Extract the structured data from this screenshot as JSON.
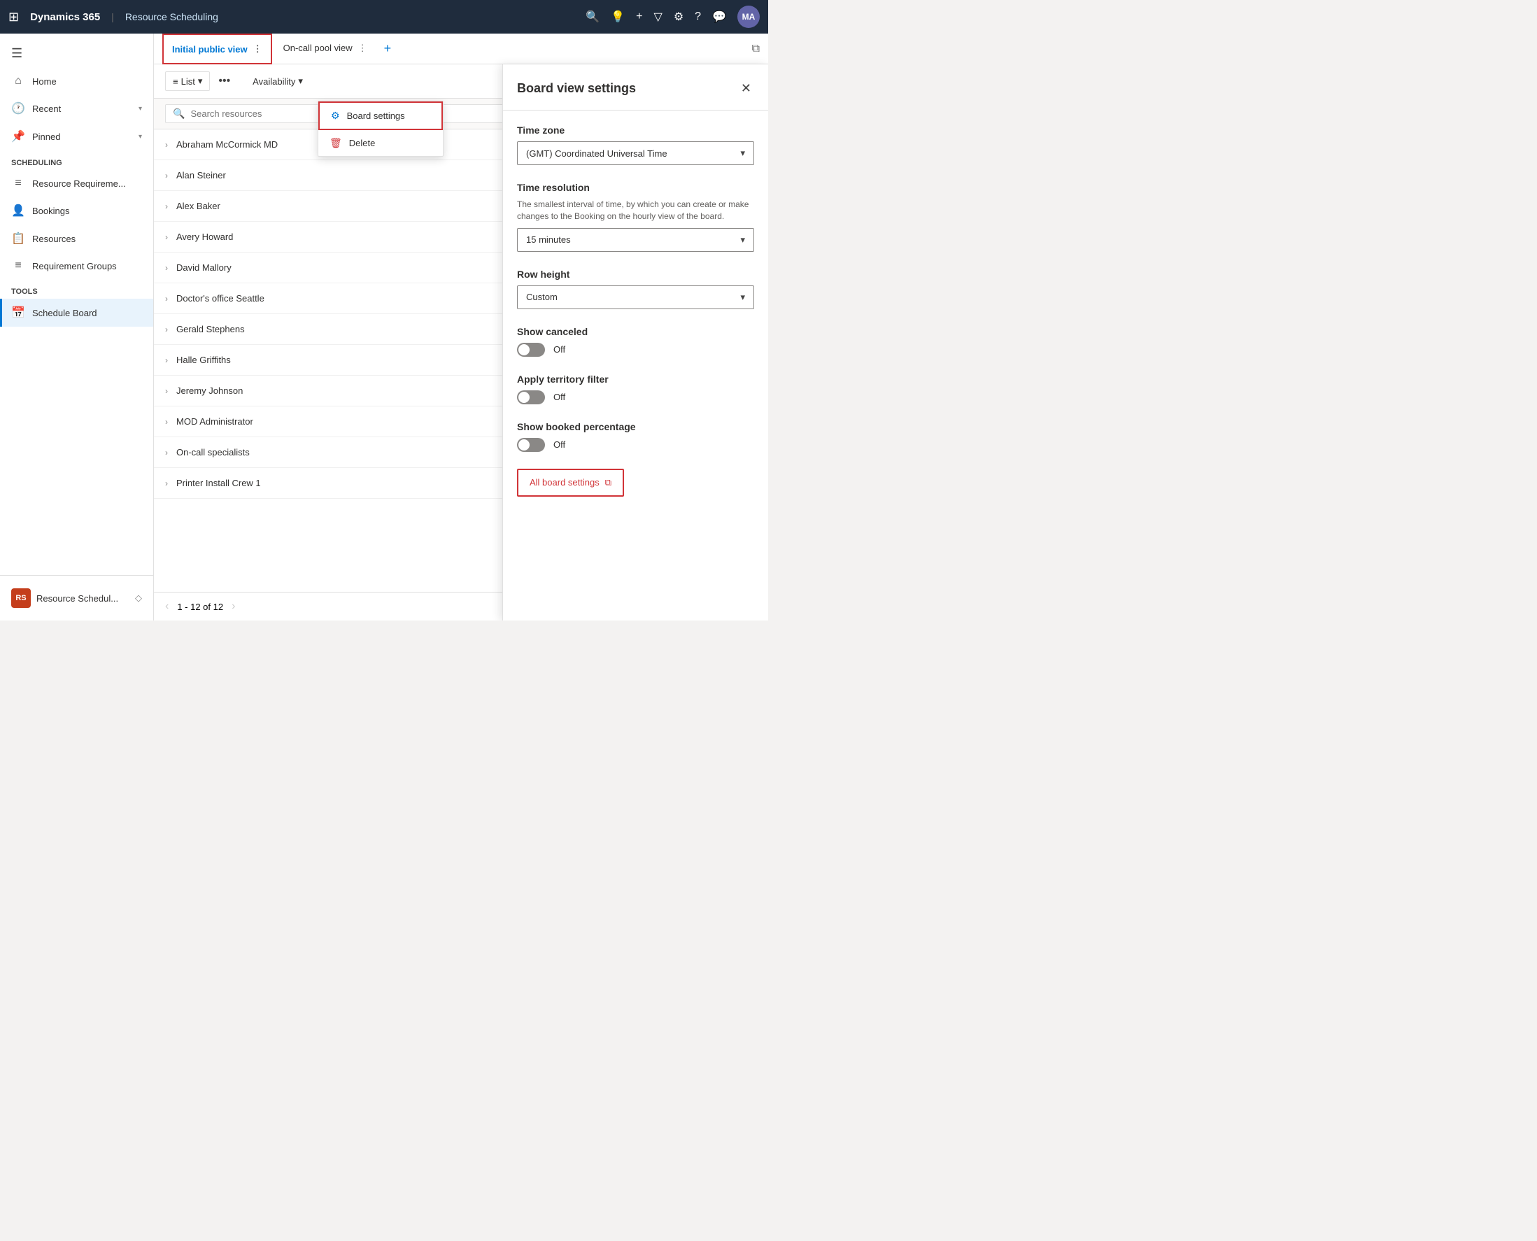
{
  "topNav": {
    "appLauncher": "⊞",
    "brand": "Dynamics 365",
    "divider": "|",
    "moduleName": "Resource Scheduling",
    "icons": [
      "🔍",
      "💡",
      "+",
      "▽",
      "⚙",
      "?",
      "💬"
    ],
    "avatar": "MA"
  },
  "sidebar": {
    "hamburger": "☰",
    "items": [
      {
        "id": "home",
        "icon": "⌂",
        "label": "Home",
        "arrow": ""
      },
      {
        "id": "recent",
        "icon": "🕐",
        "label": "Recent",
        "arrow": "▾"
      },
      {
        "id": "pinned",
        "icon": "📌",
        "label": "Pinned",
        "arrow": "▾"
      }
    ],
    "sections": [
      {
        "title": "Scheduling",
        "items": [
          {
            "id": "resource-req",
            "icon": "≡",
            "label": "Resource Requireme..."
          },
          {
            "id": "bookings",
            "icon": "👤",
            "label": "Bookings"
          },
          {
            "id": "resources",
            "icon": "📋",
            "label": "Resources"
          },
          {
            "id": "req-groups",
            "icon": "≡",
            "label": "Requirement Groups"
          }
        ]
      },
      {
        "title": "Tools",
        "items": [
          {
            "id": "schedule-board",
            "icon": "📅",
            "label": "Schedule Board",
            "active": true
          }
        ]
      }
    ],
    "bottom": {
      "initials": "RS",
      "label": "Resource Schedul...",
      "arrow": "◇"
    }
  },
  "tabs": [
    {
      "id": "initial-public",
      "label": "Initial public view",
      "active": true,
      "dots": true,
      "highlight": true
    },
    {
      "id": "on-call-pool",
      "label": "On-call pool view",
      "active": false,
      "dots": true
    }
  ],
  "addTab": "+",
  "toolbar": {
    "listBtn": "List",
    "listIcon": "≡",
    "listArrow": "▾",
    "dotsLabel": "•••",
    "availability": "Availability",
    "availArrow": "▾",
    "icons": [
      {
        "id": "view-icon",
        "symbol": "▦",
        "activeBox": false
      },
      {
        "id": "columns-icon",
        "symbol": "⊞",
        "activeBox": false
      },
      {
        "id": "alert-icon",
        "symbol": "🔔",
        "activeBox": false
      },
      {
        "id": "person-icon",
        "symbol": "👤",
        "activeBox": false
      },
      {
        "id": "settings-icon",
        "symbol": "⚙",
        "activeBox": true
      },
      {
        "id": "refresh-icon",
        "symbol": "↺",
        "activeBox": false
      },
      {
        "id": "expand-icon",
        "symbol": "⤢",
        "activeBox": false
      }
    ]
  },
  "filterBar": {
    "placeholder": "Search resources",
    "sortIcon": "⇅"
  },
  "resources": [
    {
      "name": "Abraham McCormick MD"
    },
    {
      "name": "Alan Steiner"
    },
    {
      "name": "Alex Baker"
    },
    {
      "name": "Avery Howard"
    },
    {
      "name": "David Mallory"
    },
    {
      "name": "Doctor's office Seattle"
    },
    {
      "name": "Gerald Stephens"
    },
    {
      "name": "Halle Griffiths"
    },
    {
      "name": "Jeremy Johnson"
    },
    {
      "name": "MOD Administrator"
    },
    {
      "name": "On-call specialists"
    },
    {
      "name": "Printer Install Crew 1"
    }
  ],
  "pagination": {
    "prevDisabled": true,
    "text": "1 - 12 of 12",
    "nextDisabled": true
  },
  "dropdownMenu": {
    "items": [
      {
        "id": "board-settings",
        "icon": "⚙",
        "label": "Board settings",
        "highlight": true
      },
      {
        "id": "delete",
        "icon": "🗑",
        "label": "Delete",
        "danger": true
      }
    ]
  },
  "settingsPanel": {
    "title": "Board view settings",
    "fields": [
      {
        "id": "timezone",
        "label": "Time zone",
        "type": "select",
        "value": "(GMT) Coordinated Universal Time"
      },
      {
        "id": "time-resolution",
        "label": "Time resolution",
        "type": "select",
        "description": "The smallest interval of time, by which you can create or make changes to the Booking on the hourly view of the board.",
        "value": "15 minutes"
      },
      {
        "id": "row-height",
        "label": "Row height",
        "type": "select",
        "value": "Custom"
      },
      {
        "id": "show-canceled",
        "label": "Show canceled",
        "type": "toggle",
        "value": false,
        "toggleLabel": "Off"
      },
      {
        "id": "apply-territory",
        "label": "Apply territory filter",
        "type": "toggle",
        "value": false,
        "toggleLabel": "Off"
      },
      {
        "id": "show-booked-pct",
        "label": "Show booked percentage",
        "type": "toggle",
        "value": false,
        "toggleLabel": "Off"
      }
    ],
    "allBoardSettings": "All board settings",
    "allBoardIcon": "⧉"
  }
}
